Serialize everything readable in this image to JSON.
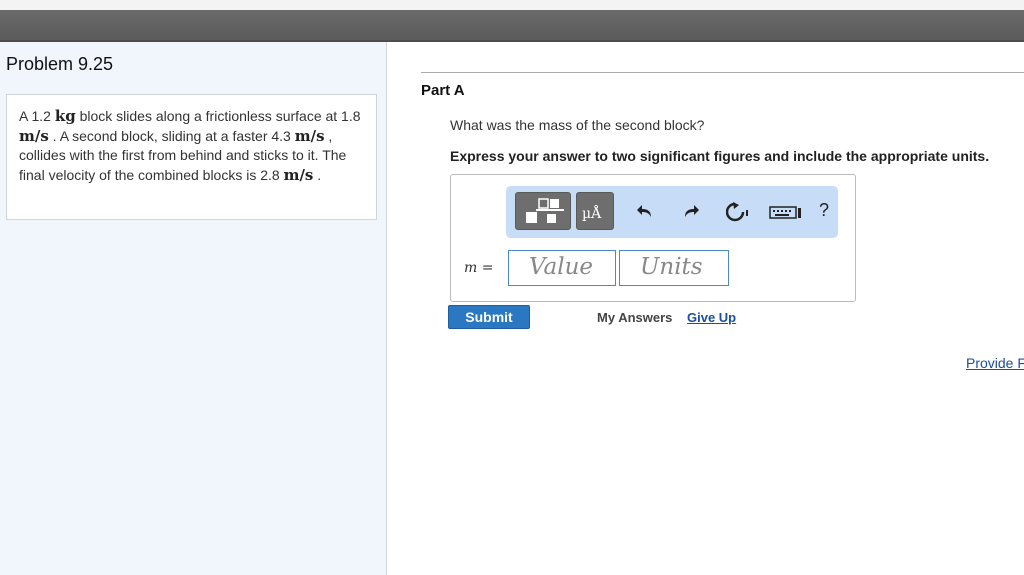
{
  "problem": {
    "title": "Problem 9.25",
    "text": {
      "p1": "A 1.2 ",
      "u1": "kg",
      "p2": " block slides along a frictionless surface at 1.8 ",
      "u2": "m/s",
      "p3": " . A second block, sliding at a faster 4.3 ",
      "u3": "m/s",
      "p4": " , collides with the first from behind and sticks to it. The final velocity of the combined blocks is 2.8 ",
      "u4": "m/s",
      "p5": " ."
    }
  },
  "part": {
    "title": "Part A",
    "question": "What was the mass of the second block?",
    "instruction": "Express your answer to two significant figures and include the appropriate units."
  },
  "answer": {
    "variable": "m =",
    "value_placeholder": "Value",
    "units_placeholder": "Units"
  },
  "toolbar": {
    "units_symbol": "µÅ",
    "help": "?"
  },
  "actions": {
    "submit": "Submit",
    "my_answers": "My Answers",
    "give_up": "Give Up",
    "provide_feedback": "Provide F"
  }
}
